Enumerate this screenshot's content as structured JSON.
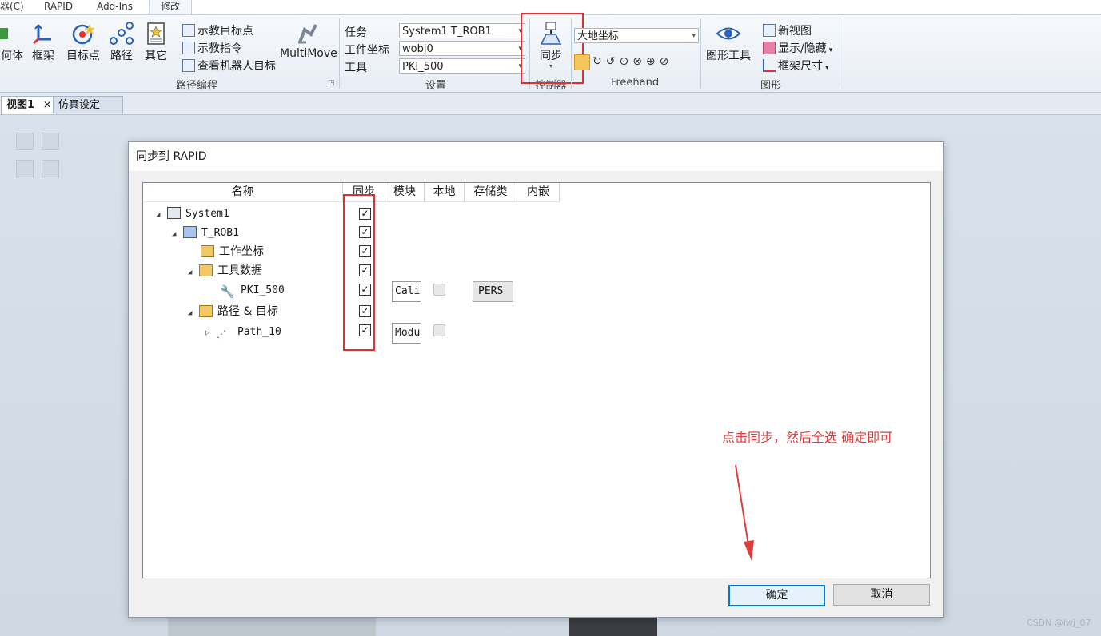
{
  "menubar": {
    "items": [
      {
        "label": "器(C)"
      },
      {
        "label": "RAPID"
      },
      {
        "label": "Add-Ins"
      },
      {
        "label": "修改"
      }
    ]
  },
  "ribbon": {
    "groups": {
      "path_programming": {
        "label": "路径编程",
        "big_buttons": [
          {
            "label": "何体"
          },
          {
            "label": "框架"
          },
          {
            "label": "目标点"
          },
          {
            "label": "路径"
          },
          {
            "label": "其它"
          }
        ],
        "small_buttons": [
          {
            "label": "示教目标点"
          },
          {
            "label": "示教指令"
          },
          {
            "label": "查看机器人目标"
          }
        ],
        "multimove_label": "MultiMove"
      },
      "settings": {
        "label": "设置",
        "task_label": "任务",
        "task_value": "System1 T_ROB1",
        "wobj_label": "工件坐标",
        "wobj_value": "wobj0",
        "tool_label": "工具",
        "tool_value": "PKI_500"
      },
      "controller": {
        "label": "控制器",
        "sync_label": "同步"
      },
      "freehand": {
        "label": "Freehand",
        "coord_value": "大地坐标"
      },
      "graphics": {
        "label": "图形",
        "graphics_tools_label": "图形工具",
        "small_buttons": [
          {
            "label": "新视图"
          },
          {
            "label": "显示/隐藏"
          },
          {
            "label": "框架尺寸"
          }
        ]
      }
    }
  },
  "doctabs": {
    "tabs": [
      {
        "label": "视图1",
        "close": "×"
      },
      {
        "label": "仿真设定"
      }
    ]
  },
  "dialog": {
    "title": "同步到 RAPID",
    "columns": [
      {
        "label": "名称"
      },
      {
        "label": "同步"
      },
      {
        "label": "模块"
      },
      {
        "label": "本地"
      },
      {
        "label": "存储类"
      },
      {
        "label": "内嵌"
      }
    ],
    "rows": [
      {
        "name": "System1",
        "expander": "◢",
        "synced": true
      },
      {
        "name": "T_ROB1",
        "expander": "◢",
        "synced": true
      },
      {
        "name": "工作坐标",
        "expander": "",
        "synced": true
      },
      {
        "name": "工具数据",
        "expander": "◢",
        "synced": true
      },
      {
        "name": "PKI_500",
        "expander": "",
        "synced": true,
        "module": "Cali",
        "local": false,
        "storage": "PERS"
      },
      {
        "name": "路径 & 目标",
        "expander": "◢",
        "synced": true
      },
      {
        "name": "Path_10",
        "expander": "▷",
        "synced": true,
        "module": "Modu",
        "local": false
      }
    ],
    "ok_label": "确定",
    "cancel_label": "取消"
  },
  "annotation": {
    "text": "点击同步，然后全选 确定即可",
    "color": "#e23b3b"
  },
  "watermark": "CSDN @lwj_07",
  "colors": {
    "highlight_red": "#e03030",
    "default_button_border": "#0078d7"
  }
}
